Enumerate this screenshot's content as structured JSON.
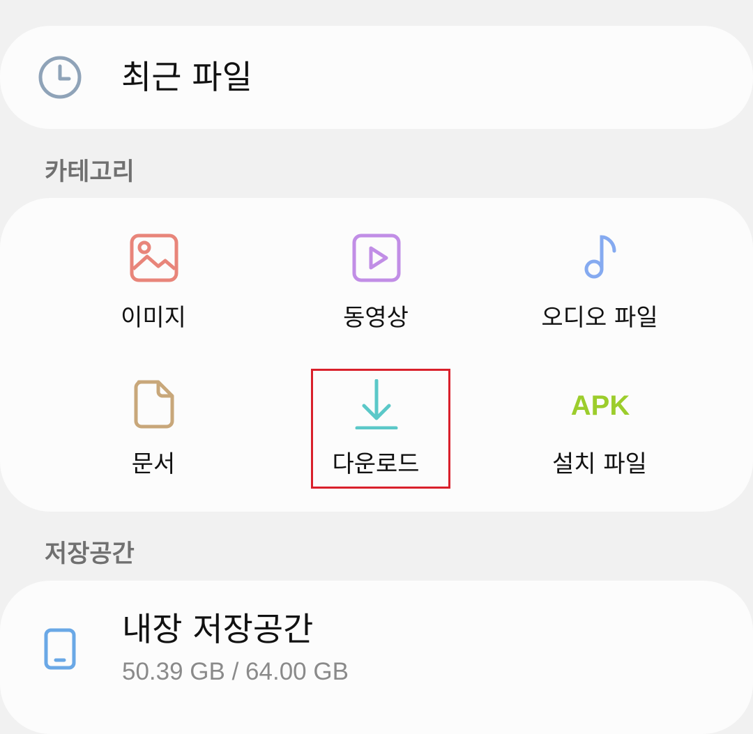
{
  "recent": {
    "icon": "clock-icon",
    "label": "최근 파일"
  },
  "categories": {
    "header": "카테고리",
    "items": [
      {
        "label": "이미지",
        "icon": "image-icon",
        "color": "#e8857a"
      },
      {
        "label": "동영상",
        "icon": "video-play-icon",
        "color": "#c18ee6"
      },
      {
        "label": "오디오 파일",
        "icon": "music-note-icon",
        "color": "#85aaf0"
      },
      {
        "label": "문서",
        "icon": "document-icon",
        "color": "#c8a77a"
      },
      {
        "label": "다운로드",
        "icon": "download-icon",
        "color": "#5bc8c8"
      },
      {
        "label": "설치 파일",
        "icon": "apk-icon",
        "icon_text": "APK",
        "color": "#9ccd2c"
      }
    ]
  },
  "storage": {
    "header": "저장공간",
    "items": [
      {
        "icon": "phone-icon",
        "title": "내장 저장공간",
        "usage": "50.39 GB / 64.00 GB",
        "color": "#6aa8e6"
      }
    ]
  },
  "highlight": {
    "target": "다운로드",
    "color": "#d9202b"
  }
}
